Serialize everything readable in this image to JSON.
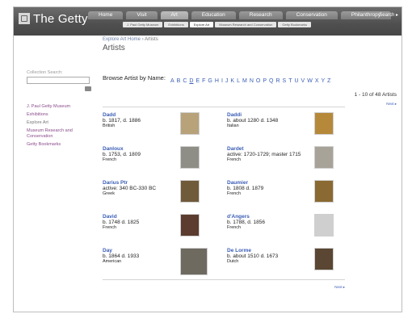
{
  "header": {
    "logo": "The Getty",
    "tabs": [
      {
        "label": "Home",
        "active": false
      },
      {
        "label": "Visit",
        "active": false
      },
      {
        "label": "Art",
        "active": true
      },
      {
        "label": "Education",
        "active": false
      },
      {
        "label": "Research",
        "active": false
      },
      {
        "label": "Conservation",
        "active": false
      },
      {
        "label": "Philanthropy",
        "active": false
      }
    ],
    "search_link": "Search ▸",
    "subnav": [
      {
        "label": "J. Paul Getty Museum",
        "active": false
      },
      {
        "label": "Exhibitions",
        "active": false
      },
      {
        "label": "Explore Art",
        "active": true
      },
      {
        "label": "Museum Research and Conservation",
        "active": false
      },
      {
        "label": "Getty Bookmarks",
        "active": false
      }
    ]
  },
  "sidebar": {
    "search_label": "Collection Search:",
    "search_value": "",
    "links": [
      {
        "label": "J. Paul Getty Museum",
        "current": false
      },
      {
        "label": "Exhibitions",
        "current": false
      },
      {
        "label": "Explore Art",
        "current": true
      },
      {
        "label": "Museum Research and Conservation",
        "current": false
      },
      {
        "label": "Getty Bookmarks",
        "current": false
      }
    ]
  },
  "main": {
    "breadcrumb": {
      "link": "Explore Art Home",
      "separator": " › ",
      "current": "Artists"
    },
    "title": "Artists",
    "browse_label": "Browse Artist by Name:",
    "alphabet": [
      "A",
      "B",
      "C",
      "D",
      "E",
      "F",
      "G",
      "H",
      "I",
      "J",
      "K",
      "L",
      "M",
      "N",
      "O",
      "P",
      "Q",
      "R",
      "S",
      "T",
      "U",
      "V",
      "W",
      "X",
      "Y",
      "Z"
    ],
    "current_letter": "D",
    "count_text": "1 - 10 of 48 Artists",
    "next_label": "Next ▸",
    "artists": [
      {
        "name": "Dadd",
        "dates": "b. 1817, d. 1886",
        "nationality": "British",
        "thumb_color": "#b7a27a"
      },
      {
        "name": "Daddi",
        "dates": "b. about 1280 d. 1348",
        "nationality": "Italian",
        "thumb_color": "#b6893a"
      },
      {
        "name": "Danloux",
        "dates": "b. 1753, d. 1809",
        "nationality": "French",
        "thumb_color": "#8e8e86"
      },
      {
        "name": "Dardet",
        "dates": "active: 1720-1729; master 1715",
        "nationality": "French",
        "thumb_color": "#a8a399"
      },
      {
        "name": "Darius Ptr",
        "dates": "active: 340 BC-330 BC",
        "nationality": "Greek",
        "thumb_color": "#6f5a3a"
      },
      {
        "name": "Daumier",
        "dates": "b. 1808 d. 1879",
        "nationality": "French",
        "thumb_color": "#8a6a32"
      },
      {
        "name": "David",
        "dates": "b. 1748 d. 1825",
        "nationality": "French",
        "thumb_color": "#5b3c2e"
      },
      {
        "name": "d'Angers",
        "dates": "b. 1788, d. 1856",
        "nationality": "French",
        "thumb_color": "#cfcfcf"
      },
      {
        "name": "Day",
        "dates": "b. 1864 d. 1933",
        "nationality": "American",
        "thumb_color": "#6e6a60"
      },
      {
        "name": "De Lorme",
        "dates": "b. about 1510 d. 1673",
        "nationality": "Dutch",
        "thumb_color": "#5a4632"
      }
    ]
  }
}
